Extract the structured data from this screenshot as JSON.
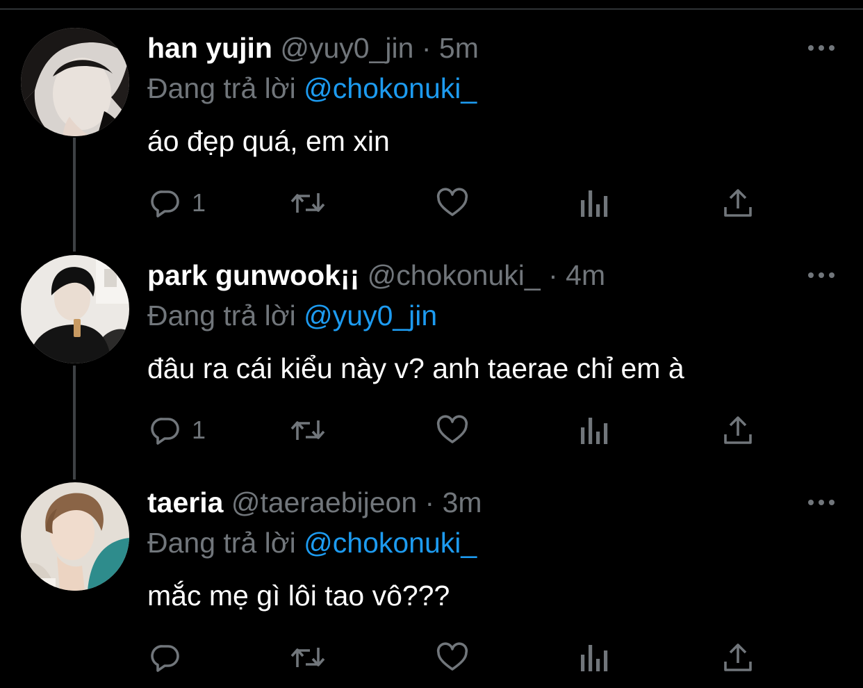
{
  "colors": {
    "background": "#000000",
    "primary_text": "#ffffff",
    "secondary_text": "#71767b",
    "link": "#1d9bf0",
    "thread_line": "#3e4144"
  },
  "tweets": [
    {
      "display_name": "han yujin",
      "handle": "@yuy0_jin",
      "separator": "·",
      "time": "5m",
      "reply_prefix": "Đang trả lời",
      "reply_to": "@chokonuki_",
      "text": "áo đẹp quá, em xin",
      "reply_count": "1",
      "icons": [
        "reply-icon",
        "retweet-icon",
        "like-icon",
        "analytics-icon",
        "share-icon",
        "more-icon"
      ]
    },
    {
      "display_name": "park gunwook¡¡",
      "handle": "@chokonuki_",
      "separator": "·",
      "time": "4m",
      "reply_prefix": "Đang trả lời",
      "reply_to": "@yuy0_jin",
      "text": "đâu ra cái kiểu này v? anh taerae chỉ em à",
      "reply_count": "1",
      "icons": [
        "reply-icon",
        "retweet-icon",
        "like-icon",
        "analytics-icon",
        "share-icon",
        "more-icon"
      ]
    },
    {
      "display_name": "taeria",
      "handle": "@taeraebijeon",
      "separator": "·",
      "time": "3m",
      "reply_prefix": "Đang trả lời",
      "reply_to": "@chokonuki_",
      "text": "mắc mẹ gì lôi tao vô???",
      "reply_count": "",
      "icons": [
        "reply-icon",
        "retweet-icon",
        "like-icon",
        "analytics-icon",
        "share-icon",
        "more-icon"
      ]
    }
  ]
}
